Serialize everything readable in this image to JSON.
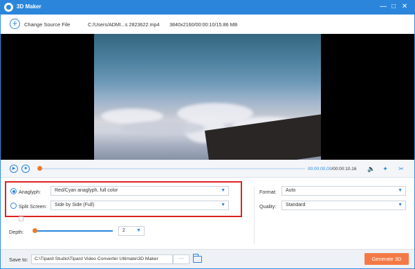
{
  "window": {
    "title": "3D Maker",
    "app_icon": "app-logo-icon",
    "controls": {
      "minimize_icon": "minimize-icon",
      "maximize_icon": "maximize-icon",
      "close_icon": "close-icon"
    }
  },
  "toolbar": {
    "change_source_label": "Change Source File",
    "add_icon": "plus-circle-icon",
    "file_path": "C:/Users/ADMI...s 2823622.mp4",
    "file_info": "3840x2160/00:00:10/15.86 MB"
  },
  "player": {
    "current_time": "00:00:00.00",
    "total_time": "/00:00:10.16",
    "progress": 0.0,
    "icons": [
      "play-icon",
      "stop-icon",
      "volume-icon",
      "pin-icon",
      "cut-icon"
    ]
  },
  "settings": {
    "anaglyph": {
      "label": "Anaglyph:",
      "selected": true,
      "value": "Red/Cyan anaglyph, full color"
    },
    "split_screen": {
      "label": "Split Screen:",
      "selected": false,
      "value": "Side by Side (Full)"
    },
    "depth": {
      "label": "Depth:",
      "value": "2"
    },
    "format": {
      "label": "Format:",
      "value": "Auto"
    },
    "quality": {
      "label": "Quality:",
      "value": "Standard"
    }
  },
  "bottom": {
    "save_to_label": "Save to:",
    "save_path": "C:\\Tipard Studio\\Tipard Video Converter Ultimate\\3D Maker",
    "browse_label": "···",
    "folder_icon": "folder-icon",
    "generate_label": "Generate 3D"
  },
  "colors": {
    "accent": "#2b86db",
    "generate_button": "#f37a46",
    "highlight_box": "#e02020"
  }
}
